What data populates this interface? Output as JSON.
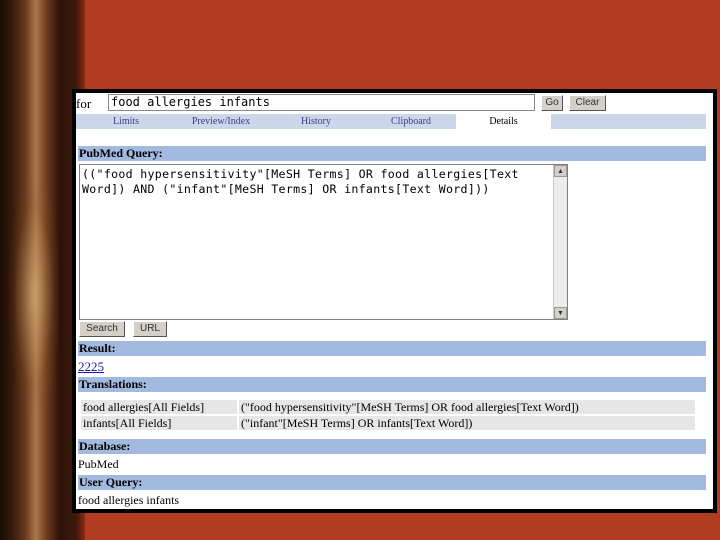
{
  "search": {
    "for_label": "for",
    "query_value": "food allergies infants",
    "go_label": "Go",
    "clear_label": "Clear"
  },
  "tabs": [
    {
      "label": "Limits",
      "active": false
    },
    {
      "label": "Preview/Index",
      "active": false
    },
    {
      "label": "History",
      "active": false
    },
    {
      "label": "Clipboard",
      "active": false
    },
    {
      "label": "Details",
      "active": true
    }
  ],
  "pubmed_query": {
    "heading": "PubMed Query:",
    "text": "((\"food hypersensitivity\"[MeSH Terms] OR food allergies[Text Word]) AND (\"infant\"[MeSH Terms] OR infants[Text Word]))",
    "search_button": "Search",
    "url_button": "URL"
  },
  "result": {
    "heading": "Result:",
    "count": "2225"
  },
  "translations": {
    "heading": "Translations:",
    "rows": [
      {
        "term": "food allergies[All Fields]",
        "translation": "(\"food hypersensitivity\"[MeSH Terms] OR food allergies[Text Word])"
      },
      {
        "term": "infants[All Fields]",
        "translation": "(\"infant\"[MeSH Terms] OR infants[Text Word])"
      }
    ]
  },
  "database": {
    "heading": "Database:",
    "value": "PubMed"
  },
  "user_query": {
    "heading": "User Query:",
    "value": "food allergies infants"
  },
  "colors": {
    "slide_background": "#b23c22",
    "section_bar": "#a3bae0",
    "tab_bar": "#cdd7ea",
    "link": "#1a1aa6"
  }
}
